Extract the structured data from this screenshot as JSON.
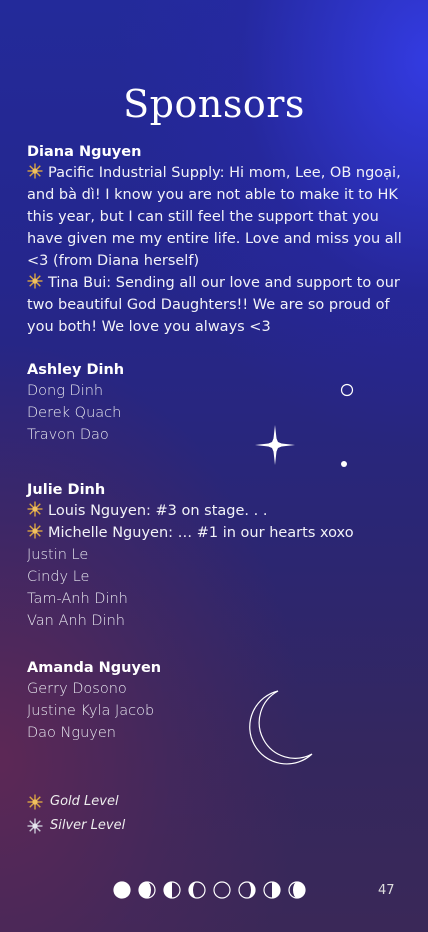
{
  "page": {
    "title": "Sponsors",
    "page_number": "47"
  },
  "sponsors": [
    {
      "name": "Diana Nguyen",
      "entries": [
        {
          "level": "gold",
          "text": "Pacific Industrial Supply: Hi mom, Lee, OB ngoại, and bà dì! I know you are not able to make it to HK this year, but I can still feel the support that you have given me my entire life. Love and miss you all <3 (from Diana herself)"
        },
        {
          "level": "gold",
          "text": "Tina Bui: Sending all our love and support to our two beautiful God Daughters!! We are so proud of you both! We love you always <3"
        }
      ]
    },
    {
      "name": "Ashley Dinh",
      "entries": [
        {
          "level": "none",
          "text": "Dong Dinh"
        },
        {
          "level": "none",
          "text": "Derek Quach"
        },
        {
          "level": "none",
          "text": "Travon Dao"
        }
      ]
    },
    {
      "name": "Julie Dinh",
      "entries": [
        {
          "level": "gold",
          "text": "Louis Nguyen: #3 on stage. . ."
        },
        {
          "level": "gold",
          "text": "Michelle Nguyen: … #1 in our hearts xoxo"
        },
        {
          "level": "none",
          "text": "Justin Le"
        },
        {
          "level": "none",
          "text": "Cindy Le"
        },
        {
          "level": "none",
          "text": "Tam-Anh Dinh"
        },
        {
          "level": "none",
          "text": "Van Anh Dinh"
        }
      ]
    },
    {
      "name": "Amanda Nguyen",
      "entries": [
        {
          "level": "none",
          "text": "Gerry Dosono"
        },
        {
          "level": "none",
          "text": "Justine Kyla Jacob"
        },
        {
          "level": "none",
          "text": "Dao Nguyen"
        }
      ]
    }
  ],
  "legend": [
    {
      "level": "gold",
      "label": "Gold Level"
    },
    {
      "level": "silver",
      "label": "Silver Level"
    }
  ],
  "colors": {
    "gold": "#d9a441",
    "silver": "#c9c9d6"
  },
  "moon_phases": [
    "full",
    "waning-gibbous",
    "last-quarter",
    "waning-crescent",
    "new",
    "waxing-crescent",
    "first-quarter",
    "waxing-gibbous"
  ]
}
